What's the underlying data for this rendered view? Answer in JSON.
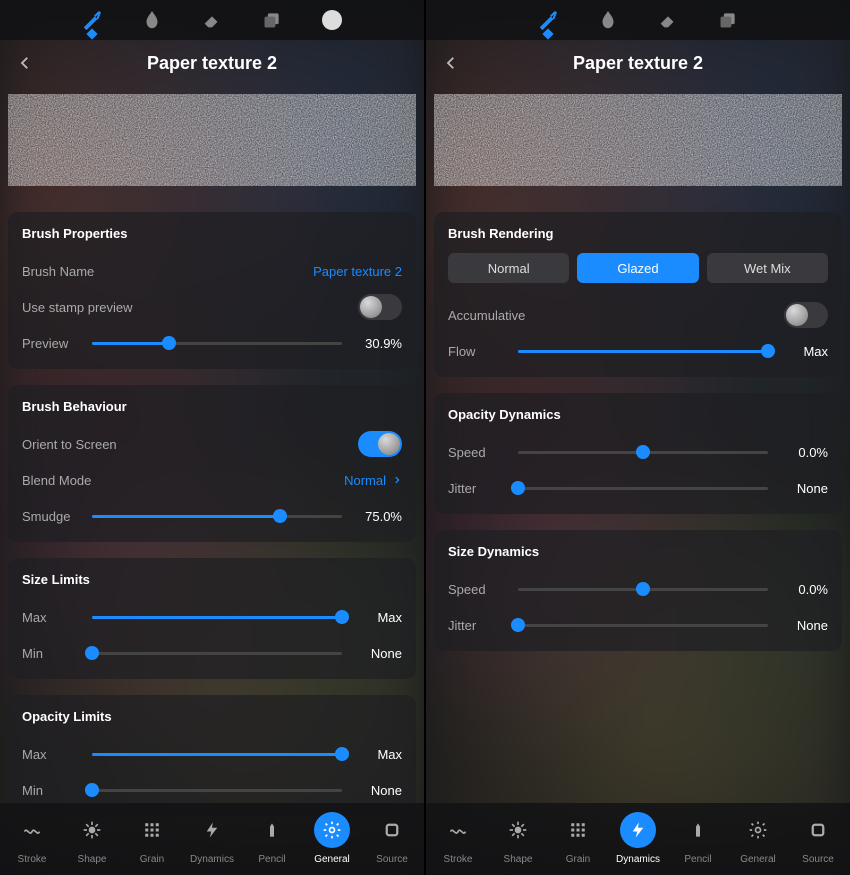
{
  "left": {
    "title": "Paper texture 2",
    "toolbar_active": 0,
    "cards": {
      "brush_properties": {
        "title": "Brush Properties",
        "brush_name_label": "Brush Name",
        "brush_name_value": "Paper texture 2",
        "stamp_label": "Use stamp preview",
        "stamp_on": false,
        "preview_label": "Preview",
        "preview_pct": 30.9,
        "preview_text": "30.9%"
      },
      "brush_behaviour": {
        "title": "Brush Behaviour",
        "orient_label": "Orient to Screen",
        "orient_on": true,
        "blend_label": "Blend Mode",
        "blend_value": "Normal",
        "smudge_label": "Smudge",
        "smudge_pct": 75.0,
        "smudge_text": "75.0%"
      },
      "size_limits": {
        "title": "Size Limits",
        "max_label": "Max",
        "max_pct": 100,
        "max_text": "Max",
        "min_label": "Min",
        "min_pct": 0,
        "min_text": "None"
      },
      "opacity_limits": {
        "title": "Opacity Limits",
        "max_label": "Max",
        "max_pct": 100,
        "max_text": "Max",
        "min_label": "Min",
        "min_pct": 0,
        "min_text": "None"
      }
    },
    "tabs": [
      {
        "label": "Stroke",
        "icon": "wave"
      },
      {
        "label": "Shape",
        "icon": "burst"
      },
      {
        "label": "Grain",
        "icon": "grid"
      },
      {
        "label": "Dynamics",
        "icon": "bolt"
      },
      {
        "label": "Pencil",
        "icon": "pencil"
      },
      {
        "label": "General",
        "icon": "gear",
        "active": true
      },
      {
        "label": "Source",
        "icon": "square"
      }
    ]
  },
  "right": {
    "title": "Paper texture 2",
    "toolbar_active": 0,
    "cards": {
      "brush_rendering": {
        "title": "Brush Rendering",
        "seg_normal": "Normal",
        "seg_glazed": "Glazed",
        "seg_wetmix": "Wet Mix",
        "seg_active": 1,
        "accum_label": "Accumulative",
        "accum_on": false,
        "flow_label": "Flow",
        "flow_pct": 100,
        "flow_text": "Max"
      },
      "opacity_dynamics": {
        "title": "Opacity Dynamics",
        "speed_label": "Speed",
        "speed_pct": 50,
        "speed_text": "0.0%",
        "jitter_label": "Jitter",
        "jitter_pct": 0,
        "jitter_text": "None"
      },
      "size_dynamics": {
        "title": "Size Dynamics",
        "speed_label": "Speed",
        "speed_pct": 50,
        "speed_text": "0.0%",
        "jitter_label": "Jitter",
        "jitter_pct": 0,
        "jitter_text": "None"
      }
    },
    "tabs": [
      {
        "label": "Stroke",
        "icon": "wave"
      },
      {
        "label": "Shape",
        "icon": "burst"
      },
      {
        "label": "Grain",
        "icon": "grid"
      },
      {
        "label": "Dynamics",
        "icon": "bolt",
        "active": true
      },
      {
        "label": "Pencil",
        "icon": "pencil"
      },
      {
        "label": "General",
        "icon": "gear"
      },
      {
        "label": "Source",
        "icon": "square"
      }
    ]
  },
  "toolbar_icons": [
    "brush",
    "smudge",
    "eraser",
    "layers",
    "color"
  ]
}
